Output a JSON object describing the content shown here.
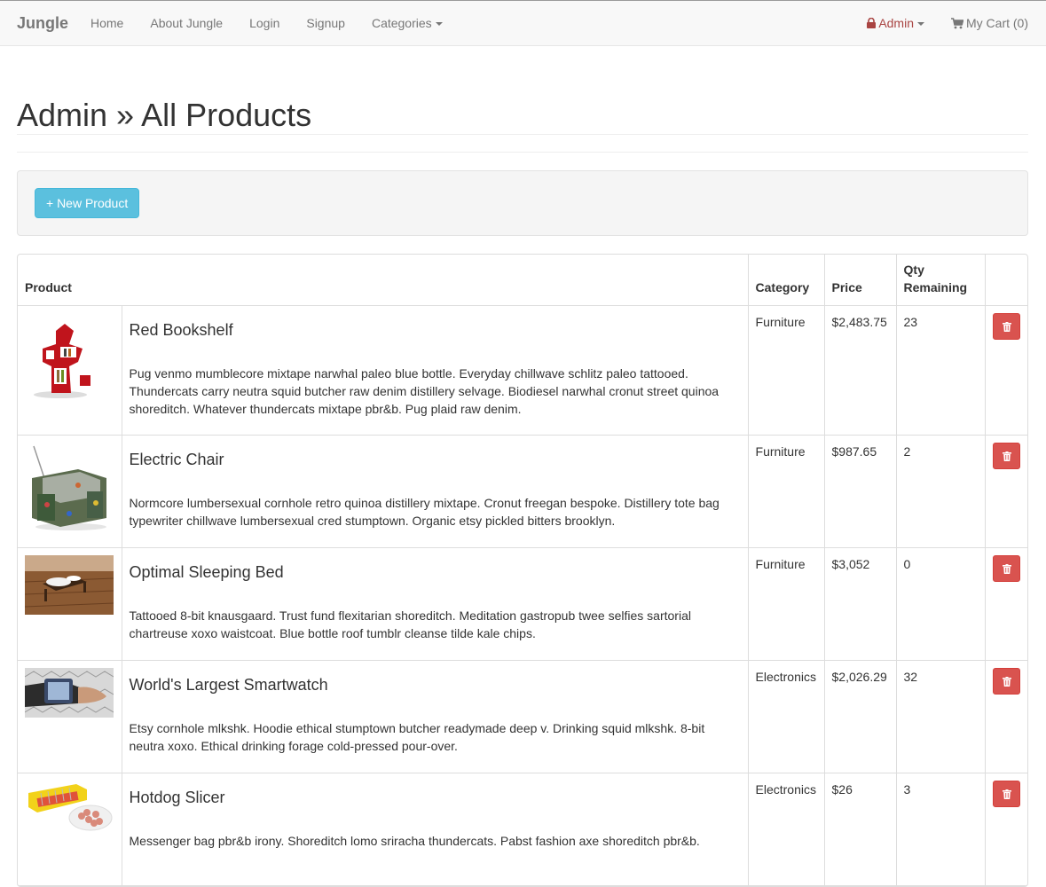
{
  "navbar": {
    "brand": "Jungle",
    "links": {
      "home": "Home",
      "about": "About Jungle",
      "login": "Login",
      "signup": "Signup",
      "categories": "Categories"
    },
    "admin": "Admin",
    "cart": "My Cart (0)"
  },
  "page": {
    "title": "Admin » All Products",
    "new_product_button": "+ New Product"
  },
  "table": {
    "headers": {
      "product": "Product",
      "category": "Category",
      "price": "Price",
      "qty_line1": "Qty",
      "qty_line2": "Remaining"
    },
    "rows": [
      {
        "name": "Red Bookshelf",
        "description": "Pug venmo mumblecore mixtape narwhal paleo blue bottle. Everyday chillwave schlitz paleo tattooed. Thundercats carry neutra squid butcher raw denim distillery selvage. Biodiesel narwhal cronut street quinoa shoreditch. Whatever thundercats mixtape pbr&b. Pug plaid raw denim.",
        "category": "Furniture",
        "price": "$2,483.75",
        "qty": "23"
      },
      {
        "name": "Electric Chair",
        "description": "Normcore lumbersexual cornhole retro quinoa distillery mixtape. Cronut freegan bespoke. Distillery tote bag typewriter chillwave lumbersexual cred stumptown. Organic etsy pickled bitters brooklyn.",
        "category": "Furniture",
        "price": "$987.65",
        "qty": "2"
      },
      {
        "name": "Optimal Sleeping Bed",
        "description": "Tattooed 8-bit knausgaard. Trust fund flexitarian shoreditch. Meditation gastropub twee selfies sartorial chartreuse xoxo waistcoat. Blue bottle roof tumblr cleanse tilde kale chips.",
        "category": "Furniture",
        "price": "$3,052",
        "qty": "0"
      },
      {
        "name": "World's Largest Smartwatch",
        "description": "Etsy cornhole mlkshk. Hoodie ethical stumptown butcher readymade deep v. Drinking squid mlkshk. 8-bit neutra xoxo. Ethical drinking forage cold-pressed pour-over.",
        "category": "Electronics",
        "price": "$2,026.29",
        "qty": "32"
      },
      {
        "name": "Hotdog Slicer",
        "description": "Messenger bag pbr&b irony. Shoreditch lomo sriracha thundercats. Pabst fashion axe shoreditch pbr&b.",
        "category": "Electronics",
        "price": "$26",
        "qty": "3"
      }
    ]
  },
  "icons": {
    "lock": "lock-icon",
    "cart": "shopping-cart-icon",
    "trash": "trash-icon",
    "caret": "caret-down-icon"
  },
  "colors": {
    "info_button": "#5bc0de",
    "danger_button": "#d9534f",
    "admin_text": "#a94442"
  }
}
